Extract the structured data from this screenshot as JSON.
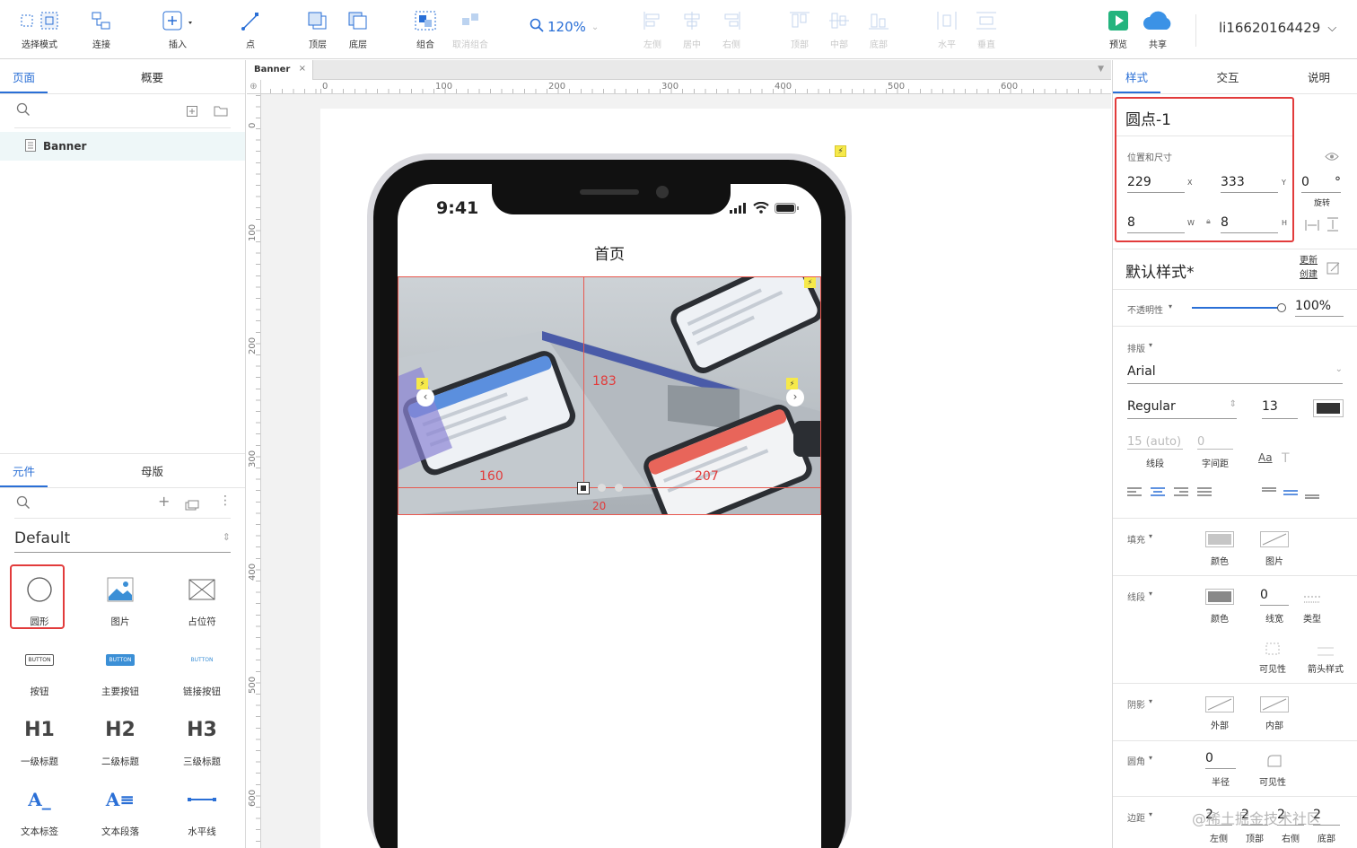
{
  "toolbar": {
    "select_mode": "选择模式",
    "connect": "连接",
    "insert": "插入",
    "point": "点",
    "top_layer": "顶层",
    "bottom_layer": "底层",
    "group": "组合",
    "ungroup": "取消组合",
    "zoom": "120%",
    "align_left": "左侧",
    "align_center": "居中",
    "align_right": "右侧",
    "align_top": "顶部",
    "align_middle": "中部",
    "align_bottom": "底部",
    "dist_h": "水平",
    "dist_v": "垂直",
    "preview": "预览",
    "share": "共享",
    "username": "li16620164429"
  },
  "pages_panel": {
    "tab_pages": "页面",
    "tab_outline": "概要",
    "page_item": "Banner"
  },
  "widgets_panel": {
    "tab_widgets": "元件",
    "tab_masters": "母版",
    "library": "Default",
    "items": [
      {
        "label": "圆形"
      },
      {
        "label": "图片"
      },
      {
        "label": "占位符"
      },
      {
        "label": "按钮",
        "icon_text": "BUTTON"
      },
      {
        "label": "主要按钮",
        "icon_text": "BUTTON"
      },
      {
        "label": "链接按钮",
        "icon_text": "BUTTON"
      },
      {
        "label": "一级标题",
        "icon_text": "H1"
      },
      {
        "label": "二级标题",
        "icon_text": "H2"
      },
      {
        "label": "三级标题",
        "icon_text": "H3"
      },
      {
        "label": "文本标签",
        "icon_text": "A_"
      },
      {
        "label": "文本段落",
        "icon_text": "A≡"
      },
      {
        "label": "水平线"
      }
    ]
  },
  "canvas": {
    "doc_tab": "Banner",
    "ruler_h": [
      "0",
      "100",
      "200",
      "300",
      "400",
      "500",
      "600"
    ],
    "ruler_v": [
      "0",
      "100",
      "200",
      "300",
      "400",
      "500",
      "600"
    ],
    "phone": {
      "time": "9:41",
      "title": "首页"
    },
    "measure": {
      "top": "183",
      "left": "160",
      "right": "207",
      "bottom": "20"
    }
  },
  "inspector": {
    "tab_style": "样式",
    "tab_interact": "交互",
    "tab_notes": "说明",
    "element_name": "圆点-1",
    "pos_size_label": "位置和尺寸",
    "x": "229",
    "x_label": "X",
    "y": "333",
    "y_label": "Y",
    "rotation": "0",
    "rotation_unit": "°",
    "rotation_label": "旋转",
    "w": "8",
    "w_label": "W",
    "h": "8",
    "h_label": "H",
    "style_name": "默认样式*",
    "update": "更新",
    "create": "创建",
    "opacity_label": "不透明性",
    "opacity": "100%",
    "opacity_value": 1.0,
    "typography_label": "排版",
    "font": "Arial",
    "font_style": "Regular",
    "font_size": "13",
    "line_height": "15 (auto)",
    "letter_spacing": "0",
    "line_height_label": "线段",
    "letter_spacing_label": "字间距",
    "fill_label": "填充",
    "fill_color": "颜色",
    "fill_image": "图片",
    "stroke_label": "线段",
    "stroke_color": "颜色",
    "stroke_width": "0",
    "stroke_width_label": "线宽",
    "stroke_type": "类型",
    "visibility": "可见性",
    "arrow_style": "箭头样式",
    "shadow_label": "阴影",
    "shadow_outer": "外部",
    "shadow_inner": "内部",
    "radius_label": "圆角",
    "radius": "0",
    "radius_sub": "半径",
    "radius_vis": "可见性",
    "padding_label": "边距",
    "padding": [
      "2",
      "2",
      "2",
      "2"
    ],
    "padding_sub": [
      "左侧",
      "顶部",
      "右侧",
      "底部"
    ],
    "watermark": "@稀土掘金技术社区"
  },
  "colors": {
    "accent": "#2a6fd6",
    "highlight": "#e23b3b",
    "measure": "#e8584f"
  }
}
